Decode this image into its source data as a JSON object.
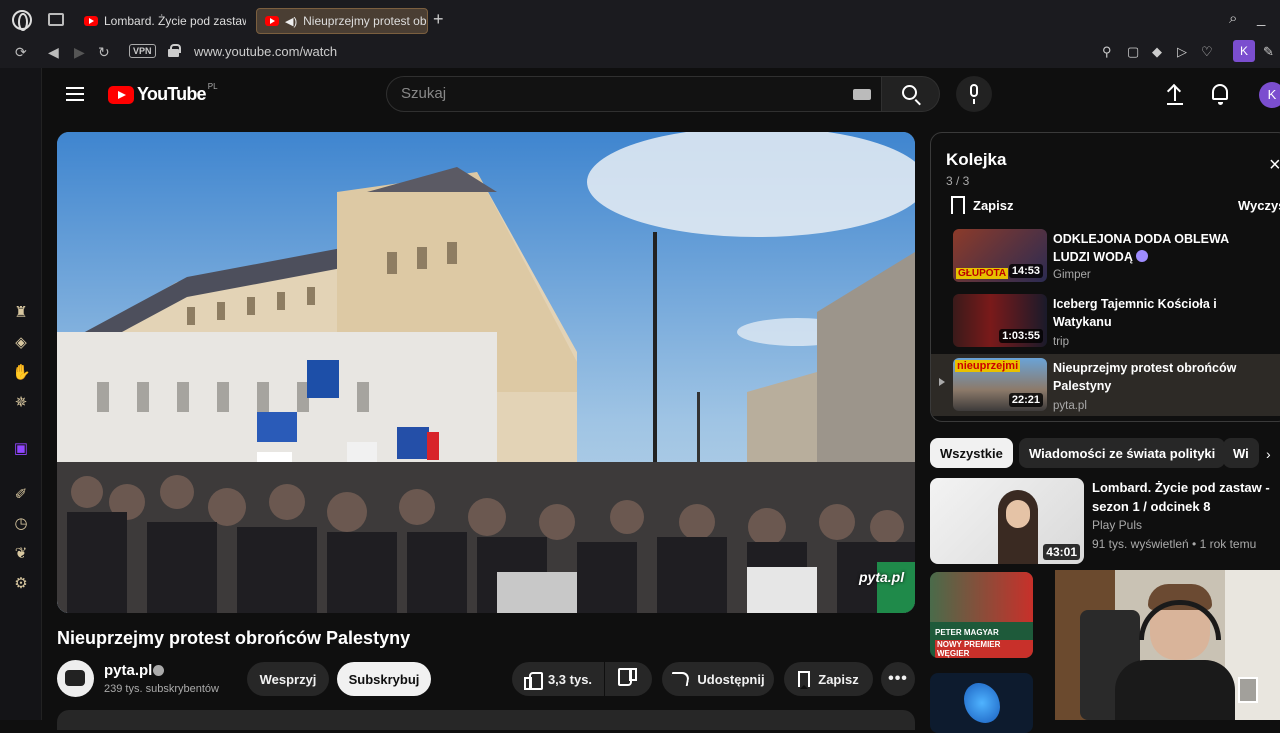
{
  "browser": {
    "tabs": [
      {
        "label": "Lombard. Życie pod zastaw"
      },
      {
        "label": "Nieuprzejmy protest ob"
      }
    ],
    "new_tab": "+",
    "url": "www.youtube.com/watch",
    "vpn_label": "VPN",
    "profile_initial": "K"
  },
  "youtube": {
    "logo_text": "YouTube",
    "country_code": "PL",
    "search_placeholder": "Szukaj",
    "avatar_initial": "K"
  },
  "video": {
    "title": "Nieuprzejmy protest obrońców Palestyny",
    "watermark": "pyta.pl",
    "channel": "pyta.pl",
    "subscribers": "239 tys. subskrybentów",
    "support_label": "Wesprzyj",
    "subscribe_label": "Subskrybuj",
    "likes": "3,3 tys.",
    "share_label": "Udostępnij",
    "save_label": "Zapisz",
    "more_label": "•••"
  },
  "queue": {
    "title": "Kolejka",
    "count": "3 / 3",
    "save_label": "Zapisz",
    "clear_label": "Wyczyść",
    "close_label": "×",
    "items": [
      {
        "title": "ODKLEJONA DODA OBLEWA LUDZI WODĄ",
        "channel": "Gimper",
        "duration": "14:53",
        "thumb_text": "GŁUPOTA"
      },
      {
        "title": "Iceberg Tajemnic Kościoła i Watykanu",
        "channel": "trip",
        "duration": "1:03:55"
      },
      {
        "title": "Nieuprzejmy protest obrońców Palestyny",
        "channel": "pyta.pl",
        "duration": "22:21",
        "thumb_text": "nieuprzejmi"
      }
    ]
  },
  "chips": [
    "Wszystkie",
    "Wiadomości ze świata polityki",
    "Wi"
  ],
  "recommendations": [
    {
      "title": "Lombard. Życie pod zastaw - sezon 1 / odcinek 8",
      "channel": "Play Puls",
      "meta": "91 tys. wyświetleń • 1 rok temu",
      "duration": "43:01"
    },
    {
      "thumb_text_1": "PETER MAGYAR",
      "thumb_text_2": "NOWY PREMIER WĘGIER"
    }
  ]
}
